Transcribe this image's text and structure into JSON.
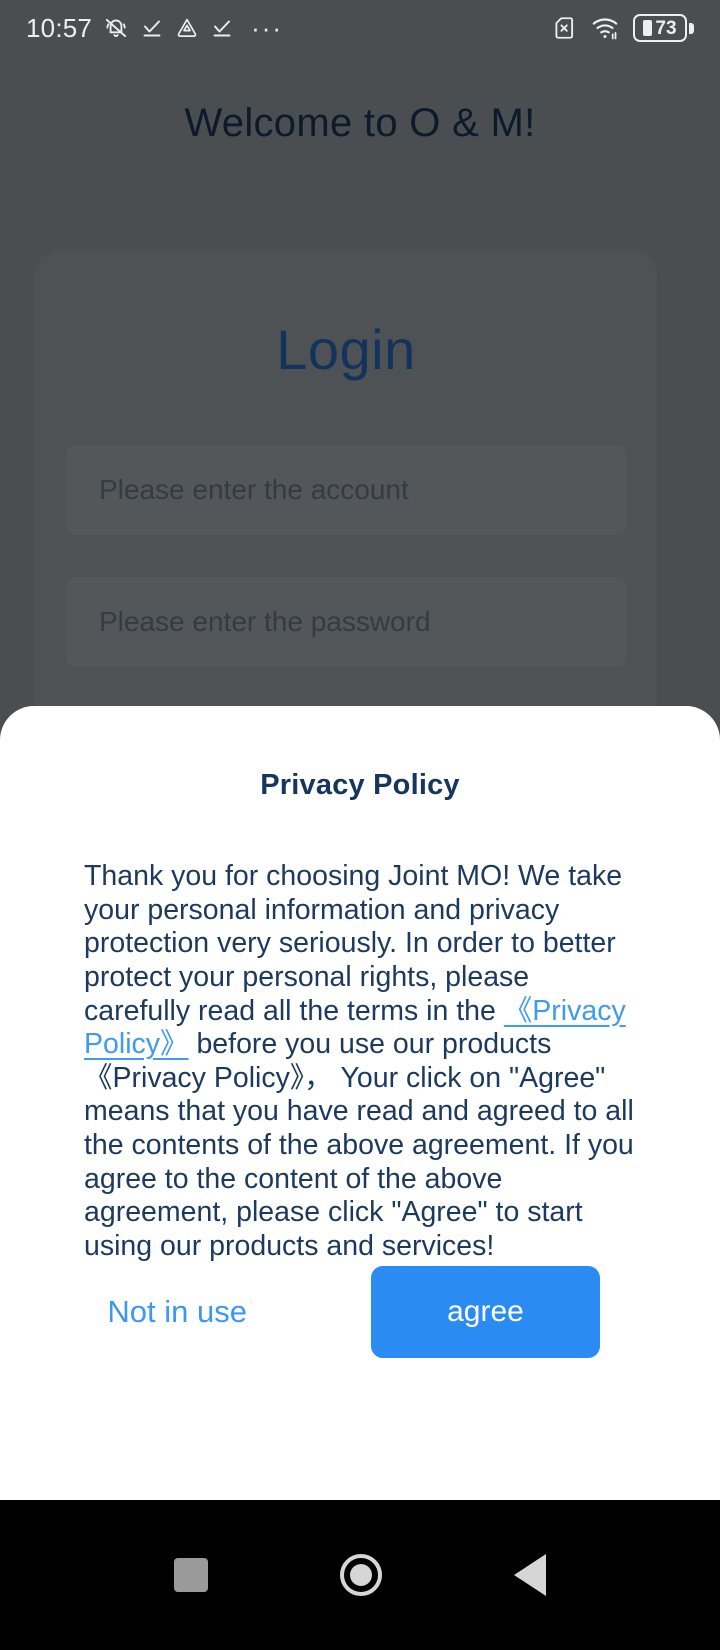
{
  "statusbar": {
    "time": "10:57",
    "left_icons": [
      "bell-muted-icon",
      "check-underline-icon",
      "triangle-alert-icon",
      "check-underline-icon"
    ],
    "overflow": "···",
    "right_icons": [
      "no-sim-icon",
      "wifi-icon"
    ],
    "battery_level": "73"
  },
  "background": {
    "welcome_title": "Welcome to O & M!",
    "login_title": "Login",
    "account_placeholder": "Please enter the account",
    "password_placeholder": "Please enter the password"
  },
  "dialog": {
    "title": "Privacy Policy",
    "body_part1": "Thank you for choosing Joint MO! We take your personal information and privacy protection very seriously. In order to better protect your personal rights, please carefully read all the terms in the ",
    "body_link": "《Privacy Policy》",
    "body_part2": " before you use our products ",
    "body_policy_plain": "《Privacy Policy》",
    "body_part3": "， Your click on \"Agree\" means that you have read and agreed to all the contents of the above agreement. If you agree to the content of the above agreement, please click \"Agree\" to start using our products and services!",
    "decline_label": "Not in use",
    "accept_label": "agree"
  },
  "navbar": {
    "recents": "square-recents-icon",
    "home": "circle-home-icon",
    "back": "triangle-back-icon"
  },
  "colors": {
    "accent_blue": "#2a8bf2",
    "link_blue": "#3e9bf0",
    "text_navy": "#1c3a5e",
    "title_navy": "#16365e",
    "login_blue": "#1b4a86",
    "status_bg": "#6b7073"
  }
}
